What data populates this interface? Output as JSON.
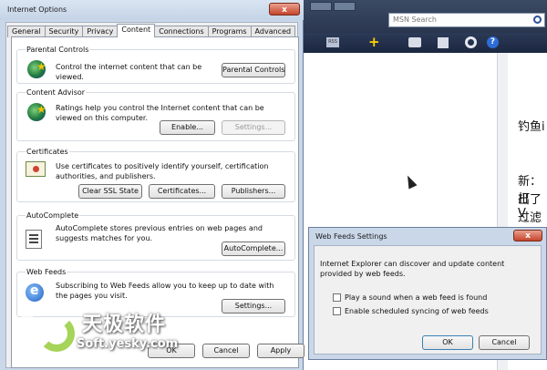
{
  "dialog": {
    "title": "Internet Options",
    "close_label": "x",
    "tabs": [
      {
        "label": "General"
      },
      {
        "label": "Security"
      },
      {
        "label": "Privacy"
      },
      {
        "label": "Content"
      },
      {
        "label": "Connections"
      },
      {
        "label": "Programs"
      },
      {
        "label": "Advanced"
      }
    ],
    "active_tab": "Content",
    "groups": {
      "parental": {
        "title": "Parental Controls",
        "text": "Control the internet content that can be viewed.",
        "button": "Parental Controls"
      },
      "advisor": {
        "title": "Content Advisor",
        "text": "Ratings help you control the Internet content that can be viewed on this computer.",
        "enable_button": "Enable...",
        "settings_button": "Settings..."
      },
      "certificates": {
        "title": "Certificates",
        "text": "Use certificates to positively identify yourself, certification authorities, and publishers.",
        "clear_ssl_button": "Clear SSL State",
        "certificates_button": "Certificates...",
        "publishers_button": "Publishers..."
      },
      "autocomplete": {
        "title": "AutoComplete",
        "text": "AutoComplete stores previous entries on web pages and suggests matches for you.",
        "button": "AutoComplete..."
      },
      "webfeeds": {
        "title": "Web Feeds",
        "text": "Subscribing to Web Feeds allow you to keep up to date with the pages you visit.",
        "button": "Settings..."
      }
    },
    "ok_label": "OK",
    "cancel_label": "Cancel",
    "apply_label": "Apply"
  },
  "browser": {
    "search_placeholder": "MSN Search",
    "rss_label": "RSS",
    "plus_label": "+",
    "help_label": "?",
    "page_text": [
      "钓鱼i",
      "新：打",
      "出了V",
      "过滤情"
    ]
  },
  "web_feeds_dialog": {
    "title": "Web Feeds Settings",
    "close_label": "x",
    "description": "Internet Explorer can discover and update content provided by web feeds.",
    "checkboxes": [
      {
        "label": "Play a sound when a web feed is found",
        "checked": false
      },
      {
        "label": "Enable scheduled syncing of web feeds",
        "checked": false
      }
    ],
    "ok_label": "OK",
    "cancel_label": "Cancel"
  },
  "watermark": {
    "cn": "天极软件",
    "en": "Soft.yesky.com"
  }
}
